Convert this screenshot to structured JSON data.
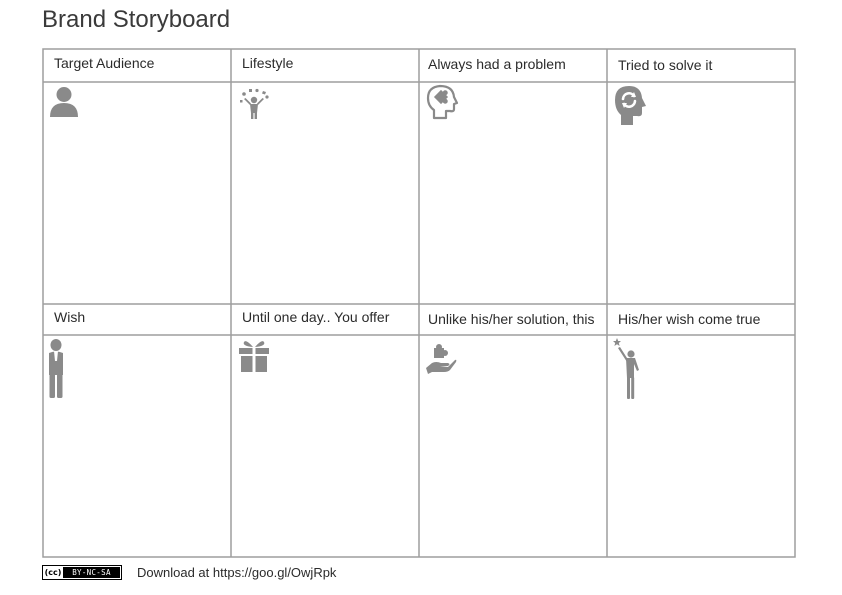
{
  "page": {
    "title": "Brand Storyboard"
  },
  "cells": [
    {
      "label": "Target Audience",
      "icon": "person-icon"
    },
    {
      "label": "Lifestyle",
      "icon": "juggling-person-icon"
    },
    {
      "label": "Always had a problem",
      "icon": "head-puzzle-icon"
    },
    {
      "label": "Tried to solve it",
      "icon": "head-refresh-icon"
    },
    {
      "label": "Wish",
      "icon": "praying-person-icon"
    },
    {
      "label": "Until one day.. You offer",
      "icon": "gift-icon"
    },
    {
      "label": "Unlike his/her solution, this",
      "icon": "hand-puzzle-icon"
    },
    {
      "label": "His/her wish come true",
      "icon": "reaching-star-icon"
    }
  ],
  "footer": {
    "license_badge": {
      "symbol": "(cc)",
      "text": "BY-NC-SA"
    },
    "download_text": "Download at https://goo.gl/OwjRpk"
  },
  "colors": {
    "grid": "#9e9e9e",
    "icon": "#8a8a8a",
    "text": "#2b2b2b"
  }
}
